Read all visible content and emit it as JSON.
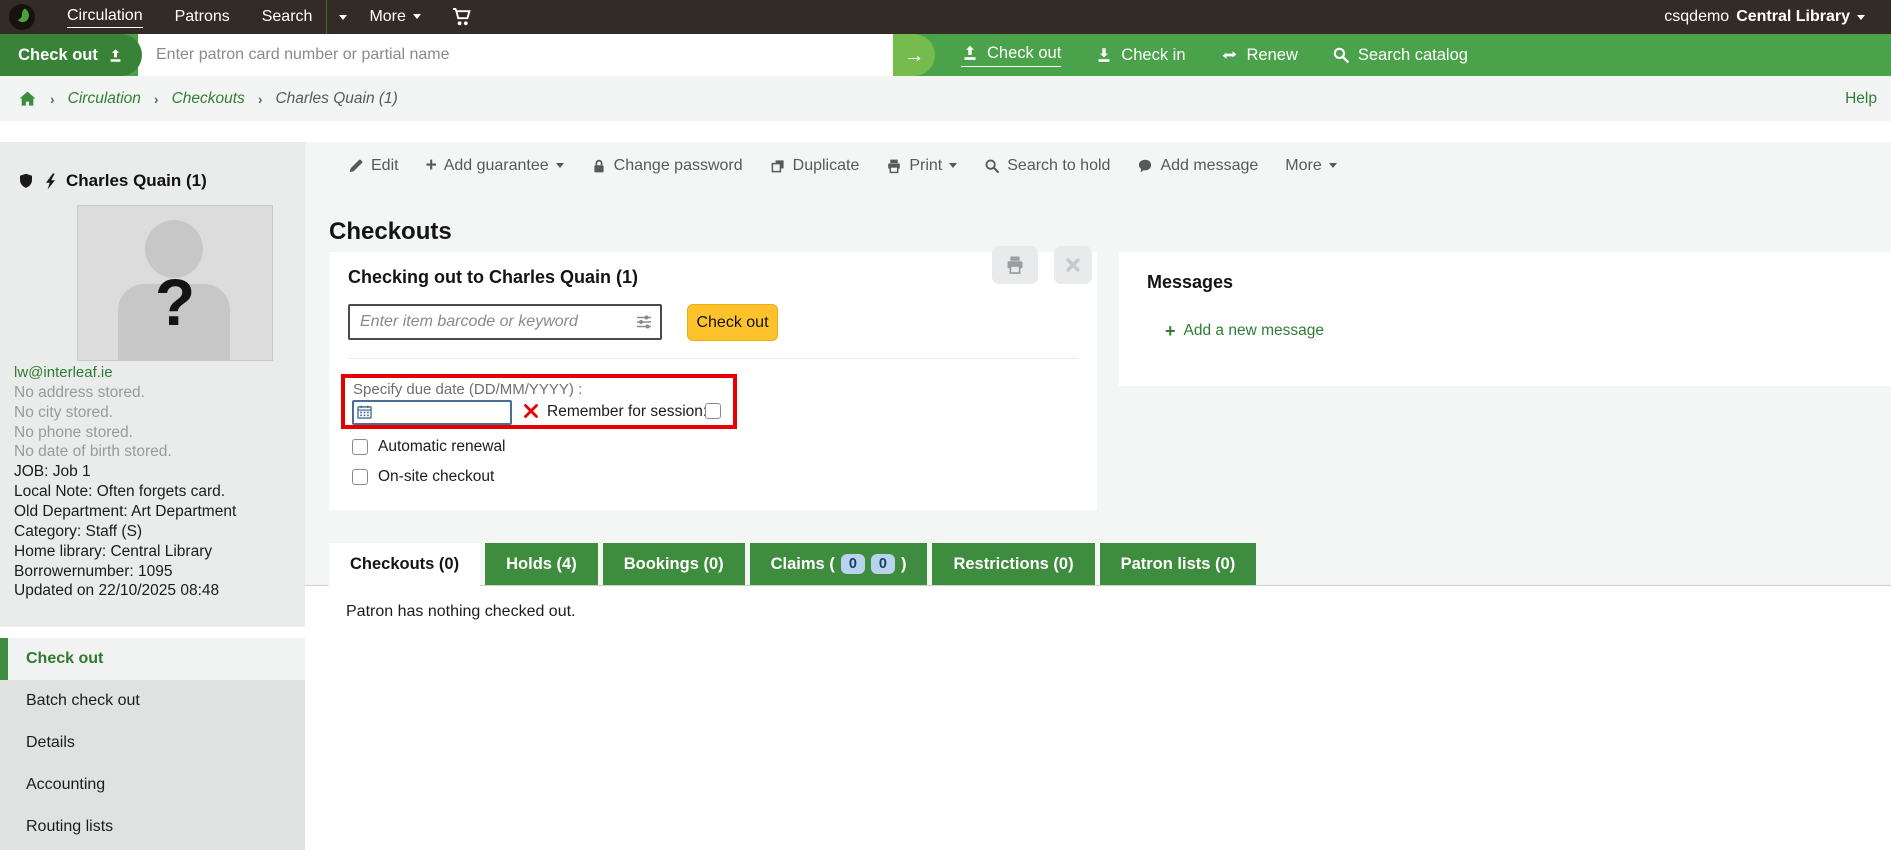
{
  "topnav": {
    "circulation": "Circulation",
    "patrons": "Patrons",
    "search": "Search",
    "more": "More",
    "user_prefix": "csqdemo",
    "library": "Central Library"
  },
  "quickbar": {
    "mode": "Check out",
    "placeholder": "Enter patron card number or partial name",
    "links": {
      "checkout": "Check out",
      "checkin": "Check in",
      "renew": "Renew",
      "search_catalog": "Search catalog"
    }
  },
  "breadcrumb": {
    "circulation": "Circulation",
    "checkouts": "Checkouts",
    "current": "Charles Quain (1)",
    "help": "Help"
  },
  "patron": {
    "name": "Charles Quain (1)",
    "avatar_glyph": "?",
    "email": "lw@interleaf.ie",
    "muted_lines": [
      "No address stored.",
      "No city stored.",
      "No phone stored.",
      "No date of birth stored."
    ],
    "detail_lines": [
      "JOB: Job 1",
      "Local Note: Often forgets card.",
      "Old Department: Art Department",
      "Category: Staff (S)",
      "Home library: Central Library",
      "Borrowernumber: 1095",
      "Updated on 22/10/2025 08:48"
    ]
  },
  "sidebar_menu": [
    {
      "label": "Check out",
      "active": true
    },
    {
      "label": "Batch check out",
      "active": false
    },
    {
      "label": "Details",
      "active": false
    },
    {
      "label": "Accounting",
      "active": false
    },
    {
      "label": "Routing lists",
      "active": false
    }
  ],
  "toolbar": {
    "edit": "Edit",
    "add_guarantee": "Add guarantee",
    "change_password": "Change password",
    "duplicate": "Duplicate",
    "print": "Print",
    "search_to_hold": "Search to hold",
    "add_message": "Add message",
    "more": "More"
  },
  "page": {
    "title": "Checkouts"
  },
  "checkout_panel": {
    "heading": "Checking out to Charles Quain (1)",
    "barcode_placeholder": "Enter item barcode or keyword",
    "checkout_button": "Check out",
    "due_date_label": "Specify due date (DD/MM/YYYY) :",
    "remember_label": "Remember for session:",
    "auto_renewal": "Automatic renewal",
    "onsite": "On-site checkout"
  },
  "tabs": [
    {
      "label": "Checkouts (0)",
      "active": true
    },
    {
      "label": "Holds (4)",
      "active": false
    },
    {
      "label": "Bookings (0)",
      "active": false
    },
    {
      "label": "Claims",
      "badges": [
        "0",
        "0"
      ],
      "active": false
    },
    {
      "label": "Restrictions (0)",
      "active": false
    },
    {
      "label": "Patron lists (0)",
      "active": false
    }
  ],
  "tab_content": {
    "empty": "Patron has nothing checked out."
  },
  "messages": {
    "title": "Messages",
    "add_new": "Add a new message"
  },
  "colors": {
    "nav_bg": "#332c26",
    "bar_green": "#4aa24a",
    "pill_green": "#398339",
    "arrow_green": "#76bb4d",
    "link_green": "#2f7d33",
    "tab_green": "#3e8c3e",
    "button_yellow": "#fec32c",
    "alert_red": "#e60000",
    "badge_blue": "#b9d2ee"
  }
}
